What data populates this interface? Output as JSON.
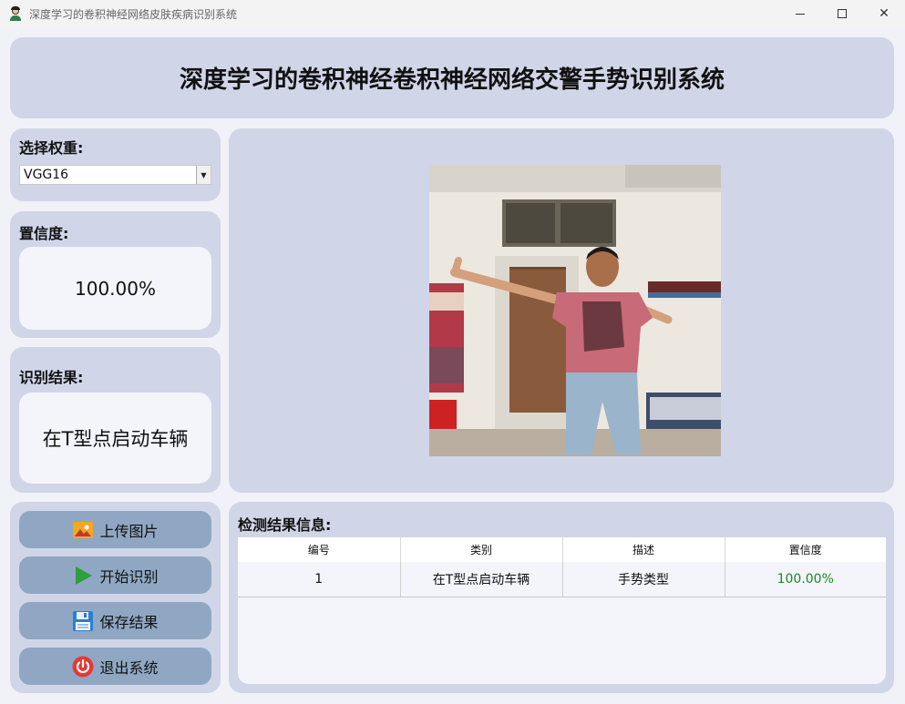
{
  "window": {
    "title": "深度学习的卷积神经网络皮肤疾病识别系统",
    "app_icon": "person-icon",
    "controls": [
      "minimize-icon",
      "maximize-icon",
      "close-icon"
    ],
    "close_glyph": "✕"
  },
  "header": {
    "title": "深度学习的卷积神经卷积神经网络交警手势识别系统"
  },
  "weight": {
    "label": "选择权重:",
    "selected": "VGG16",
    "arrow": "▼"
  },
  "confidence": {
    "label": "置信度:",
    "value": "100.00%"
  },
  "result": {
    "label": "识别结果:",
    "value": "在T型点启动车辆"
  },
  "image": {
    "description_icon": "photo-preview"
  },
  "buttons": [
    {
      "label": "上传图片",
      "icon": "image-icon",
      "color": "#f5a623"
    },
    {
      "label": "开始识别",
      "icon": "play-icon",
      "color": "#2e9e3e"
    },
    {
      "label": "保存结果",
      "icon": "save-icon",
      "color": "#2a7fd4"
    },
    {
      "label": "退出系统",
      "icon": "power-icon",
      "color": "#e53935"
    }
  ],
  "details": {
    "label": "检测结果信息:",
    "columns": [
      "编号",
      "类别",
      "描述",
      "置信度"
    ],
    "rows": [
      {
        "id": "1",
        "category": "在T型点启动车辆",
        "desc": "手势类型",
        "conf": "100.00%"
      }
    ]
  },
  "colors": {
    "panel": "#d0d6e8",
    "button": "#8fa7c2",
    "confidence_text": "#1a8a1a"
  }
}
